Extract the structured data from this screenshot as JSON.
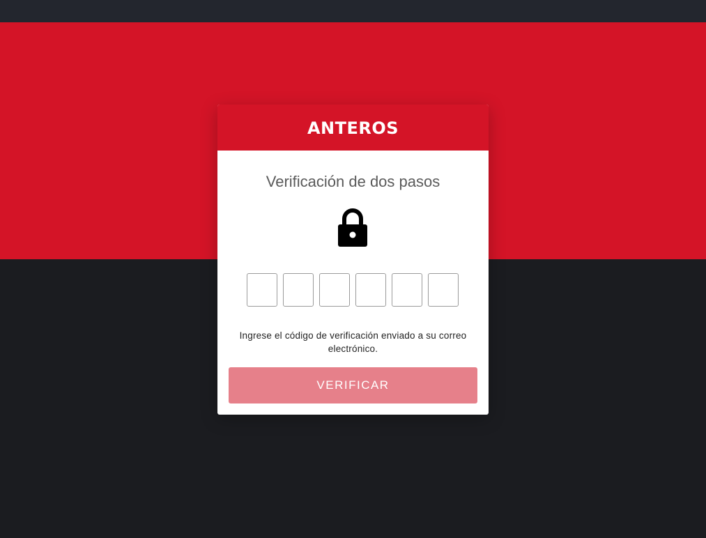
{
  "colors": {
    "brand_red": "#d41427",
    "button_disabled": "#e6808a",
    "background_dark": "#1b1c20",
    "topbar": "#23262e"
  },
  "card": {
    "brand": "ANTEROS",
    "title": "Verificación de dos pasos",
    "icon": "lock-icon",
    "code_inputs": [
      {
        "value": ""
      },
      {
        "value": ""
      },
      {
        "value": ""
      },
      {
        "value": ""
      },
      {
        "value": ""
      },
      {
        "value": ""
      }
    ],
    "helper_text": "Ingrese el código de verificación enviado a su correo electrónico.",
    "verify_label": "VERIFICAR"
  }
}
